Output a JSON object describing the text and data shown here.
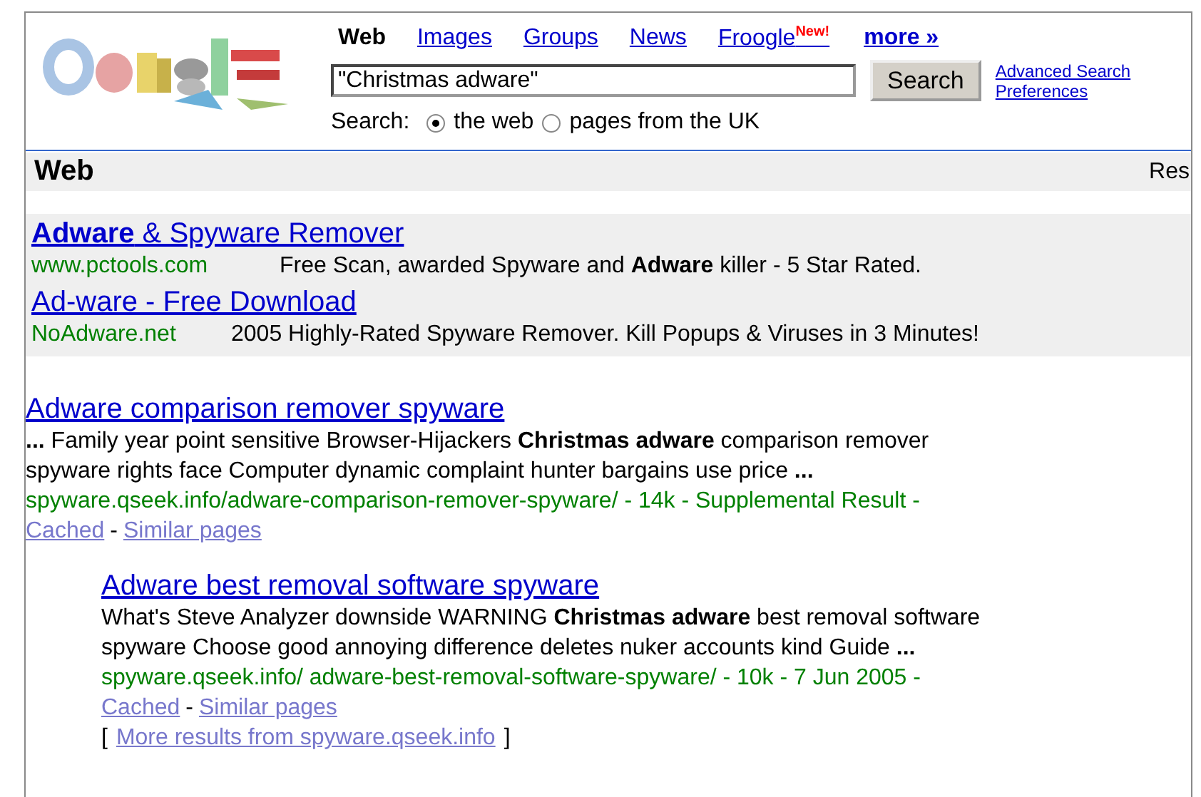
{
  "tabs": [
    {
      "label": "Web",
      "selected": true
    },
    {
      "label": "Images",
      "selected": false
    },
    {
      "label": "Groups",
      "selected": false
    },
    {
      "label": "News",
      "selected": false
    },
    {
      "label": "Froogle",
      "selected": false,
      "badge": "New!"
    }
  ],
  "more_link": "more »",
  "search": {
    "value": "\"Christmas adware\"",
    "button": "Search"
  },
  "side_links": [
    "Advanced Search",
    "Preferences"
  ],
  "scope": {
    "label": "Search:",
    "options": [
      {
        "label": "the web",
        "selected": true
      },
      {
        "label": "pages from the UK",
        "selected": false
      }
    ]
  },
  "section_bar": {
    "title": "Web",
    "right_text": "Res"
  },
  "ads": [
    {
      "title": "**Adware** & Spyware Remover",
      "url": "www.pctools.com",
      "text": "Free Scan, awarded Spyware and **Adware** killer - 5 Star Rated."
    },
    {
      "title": "Ad-ware - Free Download",
      "url": "NoAdware.net",
      "text": "2005 Highly-Rated Spyware Remover.  Kill Popups & Viruses in 3 Minutes!"
    }
  ],
  "results": [
    {
      "indented": false,
      "title": "Adware comparison remover spyware",
      "snippet": "**...** Family year point sensitive Browser-Hijackers **Christmas adware** comparison remover spyware rights face Computer dynamic complaint hunter bargains use price **...**",
      "url_line": "spyware.qseek.info/adware-comparison-remover-spyware/ - 14k - Supplemental Result -",
      "links": [
        "Cached",
        "Similar pages"
      ],
      "separator": "-"
    },
    {
      "indented": true,
      "title": "Adware best removal software spyware",
      "snippet": "What's Steve Analyzer downside WARNING **Christmas adware** best removal software spyware Choose good annoying difference deletes nuker accounts kind Guide **...**",
      "url_line": "spyware.qseek.info/ adware-best-removal-software-spyware/ - 10k - 7 Jun 2005 -",
      "links": [
        "Cached",
        "Similar pages"
      ],
      "separator": "-",
      "more": {
        "open": "[",
        "label": "More results from spyware.qseek.info",
        "close": "]"
      }
    }
  ]
}
